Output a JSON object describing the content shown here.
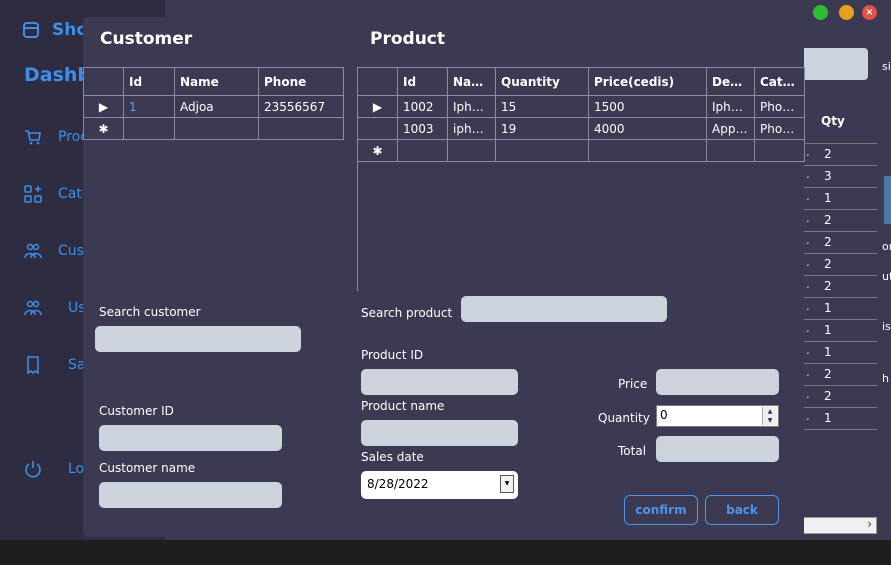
{
  "background_app": {
    "brand": "Sho",
    "dashboard": "Dashb",
    "sidebar_items": [
      "Prod",
      "Cate",
      "Custo",
      "Us",
      "Sa",
      "Log"
    ],
    "right_table_header": "Qty",
    "right_table_qty": [
      "2",
      "3",
      "1",
      "2",
      "2",
      "2",
      "2",
      "1",
      "1",
      "1",
      "2",
      "2",
      "1"
    ],
    "edge_texts": [
      "si",
      "or",
      "ut",
      "is",
      "h"
    ]
  },
  "dialog": {
    "customer": {
      "title": "Customer",
      "columns": [
        "Id",
        "Name",
        "Phone"
      ],
      "rows": [
        {
          "id": "1",
          "name": "Adjoa",
          "phone": "23556567"
        }
      ]
    },
    "product": {
      "title": "Product",
      "columns": [
        "Id",
        "Name",
        "Quantity",
        "Price(cedis)",
        "Descr...",
        "Cate..."
      ],
      "rows": [
        {
          "id": "1002",
          "name": "Ipho...",
          "quantity": "15",
          "price": "1500",
          "desc": "Ipho...",
          "cat": "Phon..."
        },
        {
          "id": "1003",
          "name": "ipho...",
          "quantity": "19",
          "price": "4000",
          "desc": "Appl...",
          "cat": "Phon..."
        }
      ]
    },
    "form": {
      "search_customer_label": "Search customer",
      "search_product_label": "Search product",
      "customer_id_label": "Customer ID",
      "customer_name_label": "Customer name",
      "product_id_label": "Product ID",
      "product_name_label": "Product name",
      "sales_date_label": "Sales date",
      "sales_date_value": "8/28/2022",
      "price_label": "Price",
      "quantity_label": "Quantity",
      "quantity_value": "0",
      "total_label": "Total"
    },
    "buttons": {
      "confirm": "confirm",
      "back": "back"
    }
  },
  "window_controls": {
    "close_glyph": "×"
  }
}
